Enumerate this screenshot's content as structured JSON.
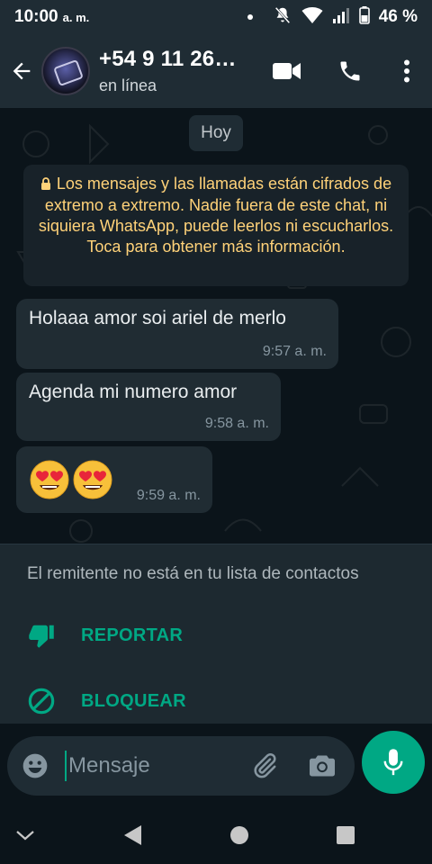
{
  "status_bar": {
    "time": "10:00",
    "ampm": "a. m.",
    "battery": "46 %",
    "icons": [
      "notification-dot-icon",
      "mute-icon",
      "wifi-icon",
      "signal-icon",
      "battery-icon"
    ]
  },
  "header": {
    "contact_name": "+54 9 11 26…",
    "status": "en línea",
    "actions": [
      "video-call-icon",
      "voice-call-icon",
      "more-options-icon"
    ]
  },
  "chat": {
    "day_label": "Hoy",
    "encryption_notice": "Los mensajes y las llamadas están cifrados de extremo a extremo. Nadie fuera de este chat, ni siquiera WhatsApp, puede leerlos ni escucharlos. Toca para obtener más información.",
    "messages": [
      {
        "text": "Holaaa amor soi ariel de merlo",
        "time": "9:57 a. m."
      },
      {
        "text": "Agenda mi numero amor",
        "time": "9:58 a. m."
      },
      {
        "text": "😍😍",
        "time": "9:59 a. m."
      }
    ]
  },
  "unknown_sender": {
    "notice": "El remitente no está en tu lista de contactos",
    "report_label": "REPORTAR",
    "block_label": "BLOQUEAR"
  },
  "composer": {
    "placeholder": "Mensaje"
  },
  "colors": {
    "accent": "#00a884",
    "header_bg": "#1f2c34",
    "chat_bg": "#0b141a",
    "bubble_bg": "#202c33",
    "notice_text": "#ffd279"
  }
}
